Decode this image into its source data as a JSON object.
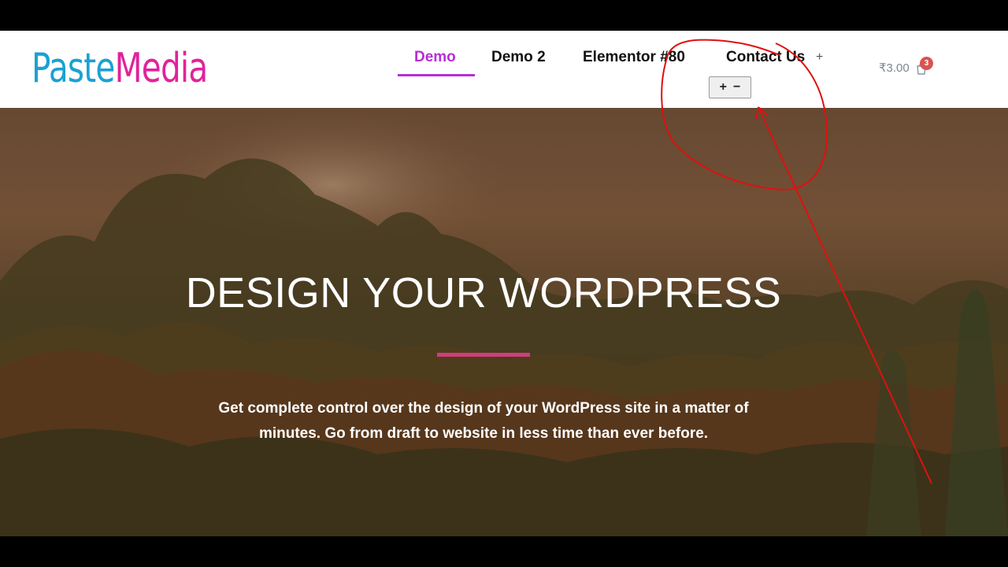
{
  "header": {
    "logo": {
      "part1": "Paste",
      "part2": "Media"
    },
    "nav": [
      {
        "label": "Demo",
        "active": true
      },
      {
        "label": "Demo 2",
        "active": false
      },
      {
        "label": "Elementor #80",
        "active": false
      },
      {
        "label": "Contact Us",
        "active": false
      }
    ],
    "expand_icon": "+",
    "submenu_toggle": {
      "plus": "+",
      "minus": "−"
    },
    "cart": {
      "price": "₹3.00",
      "count": "3"
    }
  },
  "hero": {
    "title": "DESIGN YOUR WORDPRESS",
    "text": "Get complete control over the design of your WordPress site in a matter of minutes. Go from draft to website in less time than ever before."
  },
  "colors": {
    "logo_blue": "#1ba1d1",
    "logo_pink": "#e0239b",
    "nav_active": "#b52fd8",
    "divider": "#d13d7d",
    "cart_badge": "#d9534f",
    "annotation": "#e01010"
  },
  "icons": [
    "plus-icon",
    "cart-icon",
    "red-circle-annotation",
    "red-arrow-annotation"
  ]
}
